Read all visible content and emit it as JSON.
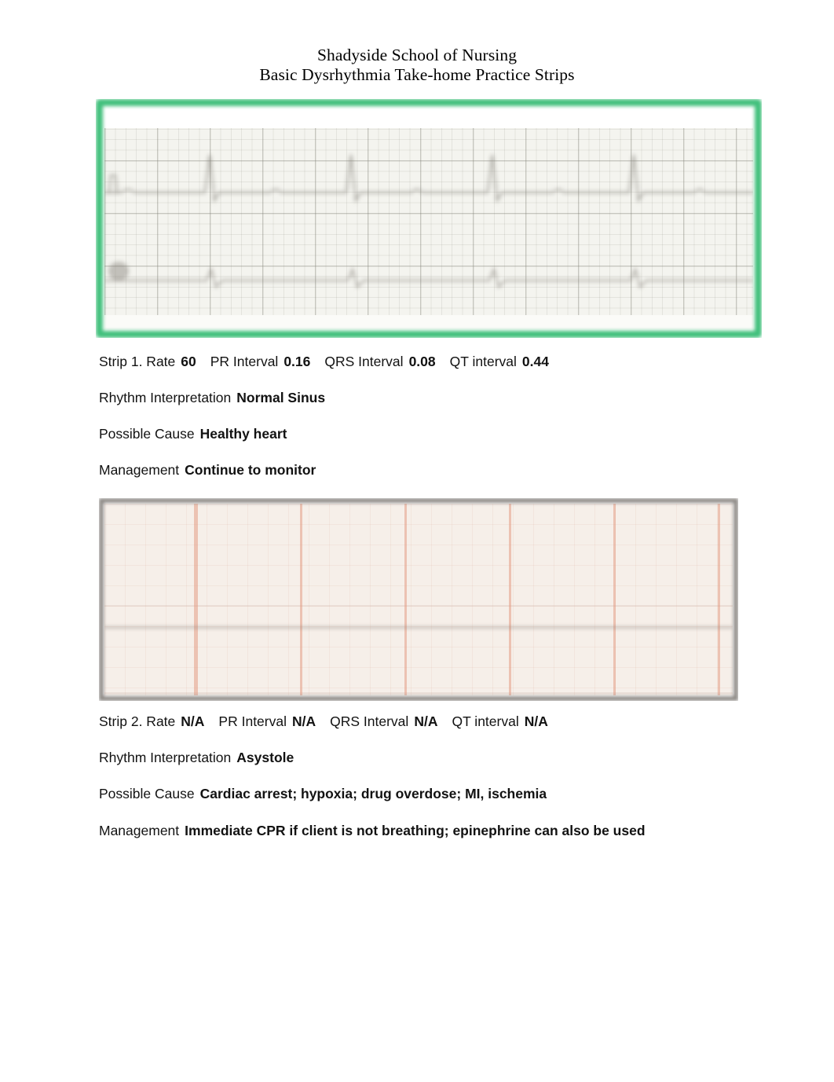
{
  "document": {
    "heading_line1": "Shadyside School of Nursing",
    "heading_line2": "Basic Dysrhythmia Take-home Practice Strips"
  },
  "strips": [
    {
      "id": "strip-1",
      "frame_color": "#41c07c",
      "paper_color": "#f4f4ef",
      "figure_alt": "ECG rhythm strip showing regular narrow QRS complexes at about 60 beats per minute",
      "fields": {
        "strip_label": "Strip 1. Rate",
        "rate_value": "60",
        "pr_label": "PR Interval",
        "pr_value": "0.16",
        "qrs_label": "QRS Interval",
        "qrs_value": "0.08",
        "qt_label": "QT interval",
        "qt_value": "0.44",
        "rhythm_label": "Rhythm Interpretation",
        "rhythm_value": "Normal Sinus",
        "cause_label": "Possible Cause",
        "cause_value": "Healthy heart",
        "management_label": "Management",
        "management_value": "Continue to monitor"
      }
    },
    {
      "id": "strip-2",
      "frame_color": "#8e8a86",
      "paper_color": "#f6efe9",
      "figure_alt": "ECG rhythm strip showing a flat line with no electrical activity (asystole)",
      "fields": {
        "strip_label": "Strip 2. Rate",
        "rate_value": "N/A",
        "pr_label": "PR Interval",
        "pr_value": "N/A",
        "qrs_label": "QRS Interval",
        "qrs_value": "N/A",
        "qt_label": "QT interval",
        "qt_value": "N/A",
        "rhythm_label": "Rhythm Interpretation",
        "rhythm_value": "Asystole",
        "cause_label": "Possible Cause",
        "cause_value": "Cardiac arrest; hypoxia; drug overdose; MI, ischemia",
        "management_label": "Management",
        "management_value": "Immediate CPR if client is not breathing; epinephrine can also be used"
      }
    }
  ]
}
